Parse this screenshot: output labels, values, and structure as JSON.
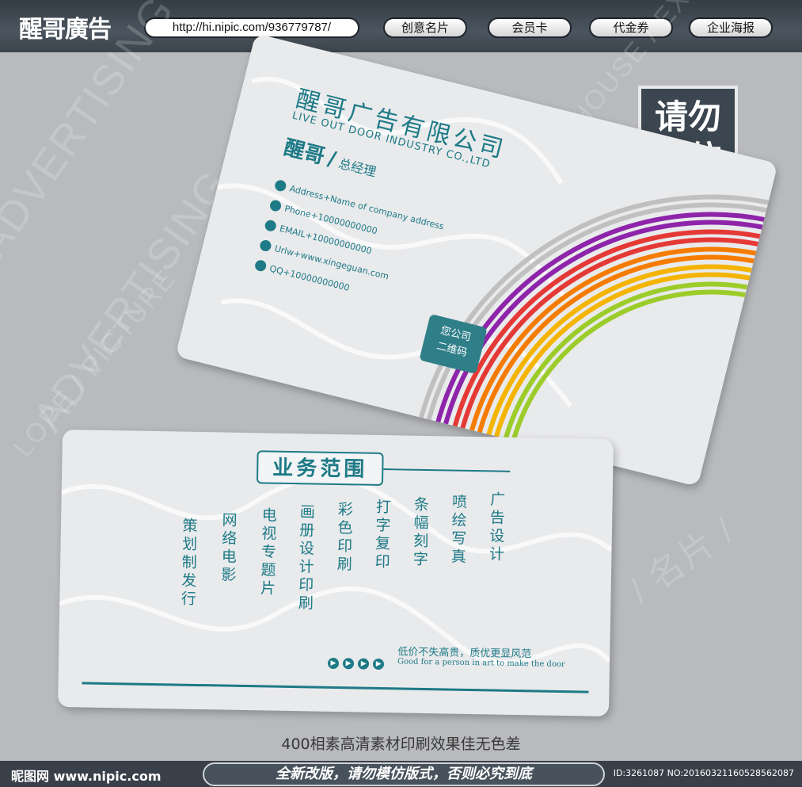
{
  "header": {
    "logo_text": "醒哥廣告",
    "url": "http://hi.nipic.com/936779787/",
    "nav": [
      "创意名片",
      "会员卡",
      "代金券",
      "企业海报"
    ]
  },
  "stamp": {
    "line1": "请勿",
    "line2": "模仿"
  },
  "background_words": [
    "ADVERTISING",
    "ADVERTISING",
    "BOX / HOUSE / EX",
    "LOPE / PICTURE",
    "/ 名片 /"
  ],
  "card_front": {
    "company_cn": "醒哥广告有限公司",
    "company_en": "LIVE OUT DOOR INDUSTRY CO.,LTD",
    "name": "醒哥",
    "title": "总经理",
    "contacts": [
      {
        "icon": "location-icon",
        "text": "Address+Name of company address"
      },
      {
        "icon": "phone-icon",
        "text": "Phone+10000000000"
      },
      {
        "icon": "email-icon",
        "text": "EMAIL+10000000000"
      },
      {
        "icon": "globe-icon",
        "text": "Urlw+www.xingeguan.com"
      },
      {
        "icon": "qq-icon",
        "text": "QQ+10000000000"
      }
    ],
    "qr_line1": "您公司",
    "qr_line2": "二维码",
    "rainbow_colors": [
      "#9ccc2a",
      "#f4b400",
      "#f57c00",
      "#e53935",
      "#8e24aa",
      "#c0c0c0"
    ]
  },
  "card_back": {
    "scope_title": "业务范围",
    "services": [
      "策划制发行",
      "网络电影",
      "电视专题片",
      "画册设计印刷",
      "彩色印刷",
      "打字复印",
      "条幅刻字",
      "喷绘写真",
      "广告设计"
    ],
    "slogan_cn": "低价不失高贵，质优更显风范",
    "slogan_en": "Good for a person in art to make the door"
  },
  "footer": {
    "tagline": "400相素高清素材印刷效果佳无色差",
    "site": "昵图网 www.nipic.com",
    "banner": "全新改版，请勿模仿版式，否则必究到底",
    "id_text": "ID:3261087 NO:20160321160528562087"
  },
  "accent_color": "#1d7a86"
}
